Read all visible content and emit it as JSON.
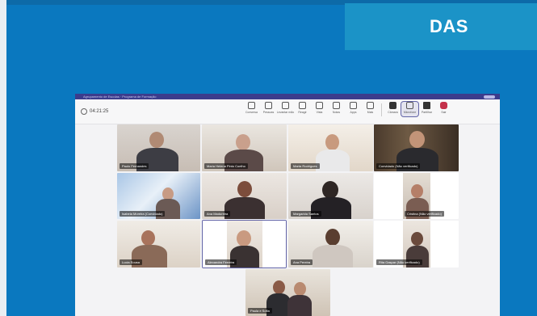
{
  "brand": {
    "label": "DAS"
  },
  "window": {
    "title": "Agrupamento de Escolas · Programa de Formação",
    "call_timer": "04:21:25"
  },
  "toolbar": {
    "items": [
      {
        "label": "Conversa",
        "icon": "chat-icon"
      },
      {
        "label": "Pessoas",
        "icon": "people-icon"
      },
      {
        "label": "Levantar mão",
        "icon": "raise-hand-icon"
      },
      {
        "label": "Reagir",
        "icon": "react-icon"
      },
      {
        "label": "Vista",
        "icon": "view-icon"
      },
      {
        "label": "Notas",
        "icon": "notes-icon"
      },
      {
        "label": "Apps",
        "icon": "apps-icon"
      },
      {
        "label": "Mais",
        "icon": "more-icon"
      },
      {
        "label": "Câmara",
        "icon": "camera-icon"
      },
      {
        "label": "Microfone",
        "icon": "microphone-icon"
      },
      {
        "label": "Partilhar",
        "icon": "share-icon"
      },
      {
        "label": "Sair",
        "icon": "leave-icon"
      }
    ]
  },
  "participants": [
    {
      "name": "Paulo Fernandes"
    },
    {
      "name": "Maria Helena Pinto Coelho"
    },
    {
      "name": "Marta Rodrigues"
    },
    {
      "name": "Convidado (Não verificado)"
    },
    {
      "name": "Isabela Moreira (Convidado)"
    },
    {
      "name": "Ana Madureira"
    },
    {
      "name": "Margarida Santos"
    },
    {
      "name": "Cristina (Não verificado)"
    },
    {
      "name": "Lucia Sousa"
    },
    {
      "name": "Alexandra Ferreira"
    },
    {
      "name": "Ana Pereira"
    },
    {
      "name": "Rita Gaspar (Não verificado)"
    },
    {
      "name": "Paula e Sofia"
    }
  ]
}
